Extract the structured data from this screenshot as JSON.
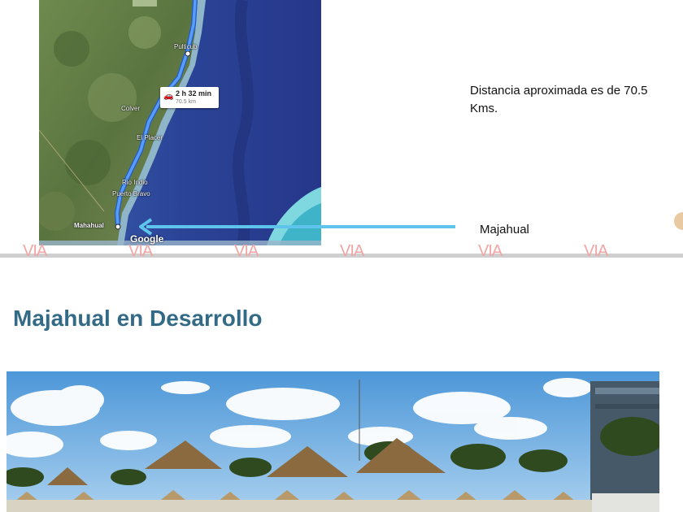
{
  "map": {
    "places": {
      "pulticub": "Pulticub",
      "colver": "Colver",
      "el_placer": "El Placer",
      "rio_indio": "Rio Indio",
      "puerto_bravo": "Puerto Bravo",
      "mahahual": "Mahahual"
    },
    "route": {
      "time": "2 h 32 min",
      "distance": "70.5 km"
    },
    "logo": "Google",
    "colors": {
      "route": "#4a8df6",
      "arrow": "#5ec4ec",
      "sea": "#2a4a9c",
      "land": "#5e7a45"
    }
  },
  "distance_text": "Distancia aproximada  es de 70.5 Kms.",
  "arrow_label": "Majahual",
  "watermark": "VIA",
  "section_title": "Majahual en Desarrollo",
  "colors": {
    "title": "#336b87",
    "divider": "#cfcfcf",
    "watermark": "#f1a5a5"
  }
}
